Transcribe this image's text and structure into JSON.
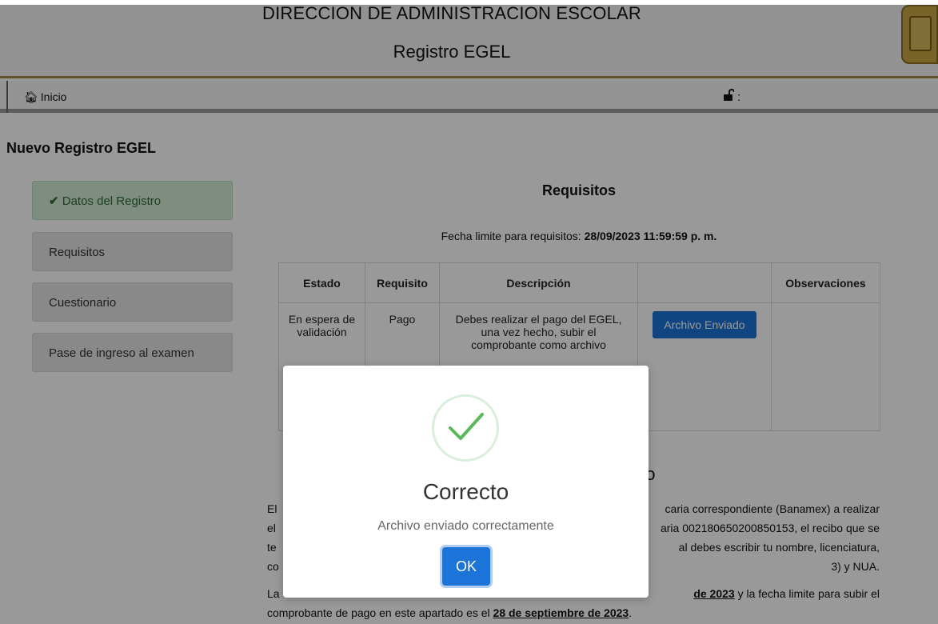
{
  "header": {
    "title": "DIRECCION DE ADMINISTRACION ESCOLAR",
    "subtitle": "Registro EGEL"
  },
  "navbar": {
    "home_label": "Inicio",
    "home_icon": "home-icon",
    "lock_icon": "unlock-icon",
    "lock_suffix": ":"
  },
  "page": {
    "section_title": "Nuevo Registro EGEL"
  },
  "sidebar": {
    "items": [
      {
        "label": "Datos del Registro",
        "state": "completed"
      },
      {
        "label": "Requisitos",
        "state": "default"
      },
      {
        "label": "Cuestionario",
        "state": "default"
      },
      {
        "label": "Pase de ingreso al examen",
        "state": "default"
      }
    ]
  },
  "requirements": {
    "title": "Requisitos",
    "deadline_label": "Fecha limite para requisitos:",
    "deadline_value": "28/09/2023 11:59:59 p. m.",
    "columns": [
      "Estado",
      "Requisito",
      "Descripción",
      "",
      "Observaciones"
    ],
    "rows": [
      {
        "estado": "En espera de validación",
        "requisito": "Pago",
        "descripcion": "Debes realizar el pago del EGEL, una vez hecho, subir el comprobante como archivo",
        "action_label": "Archivo Enviado",
        "observaciones": ""
      }
    ]
  },
  "payment": {
    "title_partial": "go",
    "para1_left": "El\nel\nte\nco",
    "para1_right": "caria correspondiente (Banamex) a realizar\naria 002180650200850153, el recibo que se\nal debes escribir tu nombre, licenciatura,\n3) y NUA.",
    "para2_prefix": "La",
    "para2_date1": "de 2023",
    "para2_mid": "y la fecha limite para subir el",
    "para2_line2": "comprobante de pago en este apartado es el",
    "para2_date2": "28 de septiembre de 2023",
    "para2_end": "."
  },
  "modal": {
    "icon": "success-check-icon",
    "title": "Correcto",
    "message": "Archivo enviado correctamente",
    "ok_label": "OK"
  },
  "colors": {
    "accent": "#1d74d8",
    "success": "#5cb85c",
    "header_border": "#a08a4a"
  }
}
